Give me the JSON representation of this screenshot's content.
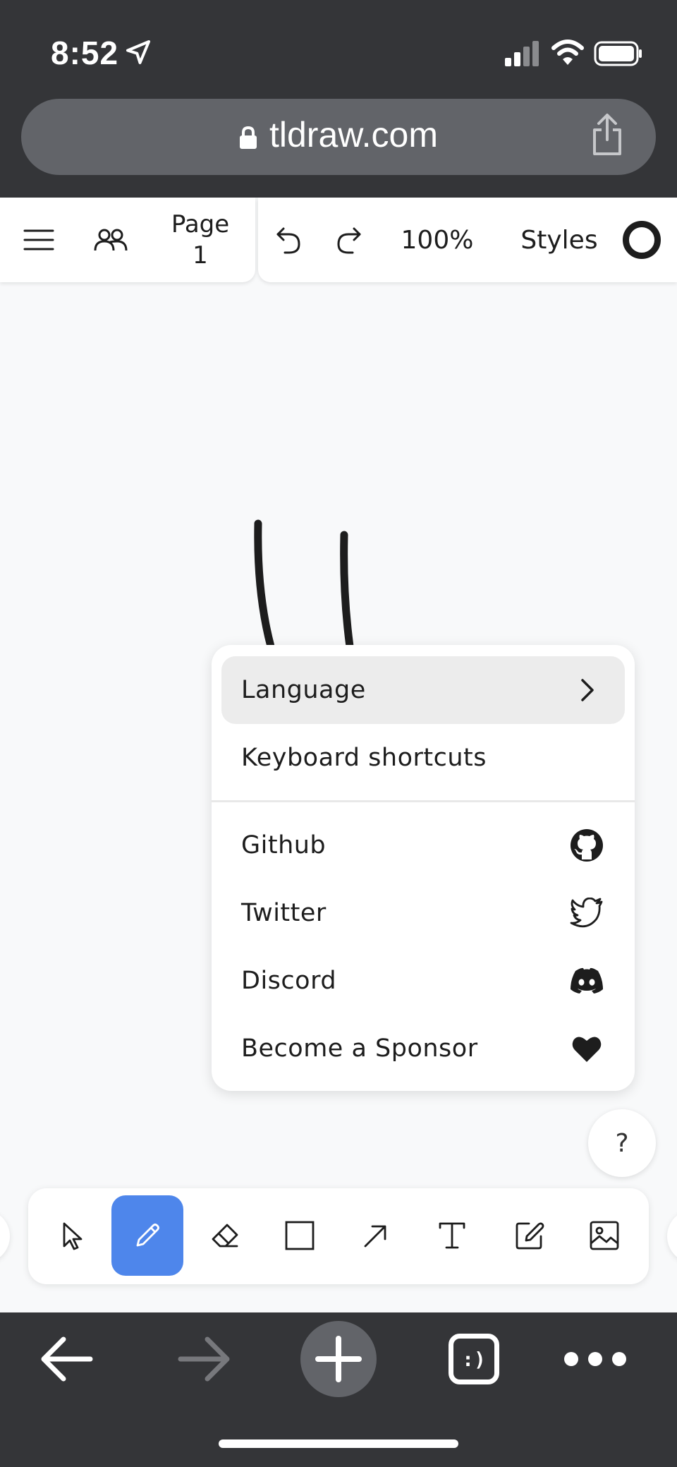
{
  "status_bar": {
    "time": "8:52"
  },
  "browser": {
    "url": "tldraw.com"
  },
  "toolbar": {
    "page_line1": "Page",
    "page_line2": "1",
    "zoom": "100%",
    "styles_label": "Styles",
    "current_color": "#1d1d1d"
  },
  "menu": {
    "items": [
      {
        "label": "Language",
        "icon": "chevron-right-icon"
      },
      {
        "label": "Keyboard shortcuts"
      },
      {
        "label": "Github",
        "icon": "github-icon"
      },
      {
        "label": "Twitter",
        "icon": "twitter-icon"
      },
      {
        "label": "Discord",
        "icon": "discord-icon"
      },
      {
        "label": "Become a Sponsor",
        "icon": "heart-icon"
      }
    ]
  },
  "help": {
    "label": "?"
  },
  "tools": {
    "selected": "draw",
    "accent": "#4e86eb",
    "items": [
      "select",
      "draw",
      "eraser",
      "rectangle",
      "arrow",
      "text",
      "sticky-note",
      "image"
    ]
  },
  "safari_bottom": {
    "tabs_label": ":)"
  }
}
